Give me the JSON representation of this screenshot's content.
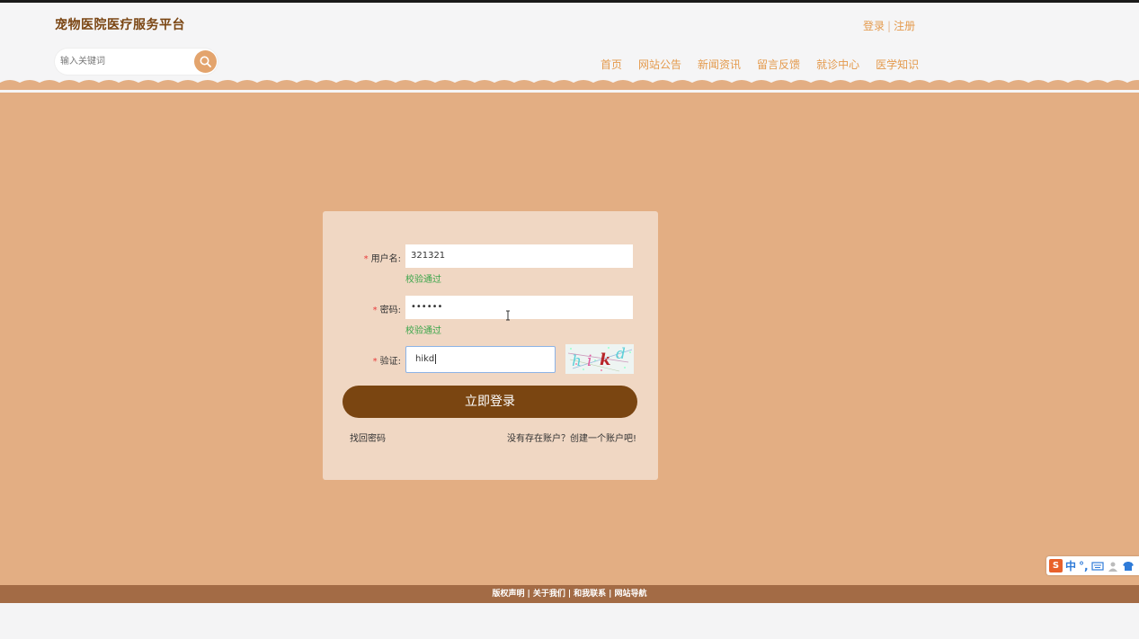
{
  "header": {
    "site_title": "宠物医院医疗服务平台",
    "login_label": "登录",
    "auth_separator": "|",
    "register_label": "注册"
  },
  "search": {
    "placeholder": "输入关键词",
    "icon": "search-icon"
  },
  "nav": {
    "items": [
      {
        "label": "首页"
      },
      {
        "label": "网站公告"
      },
      {
        "label": "新闻资讯"
      },
      {
        "label": "留言反馈"
      },
      {
        "label": "就诊中心"
      },
      {
        "label": "医学知识"
      }
    ]
  },
  "login_form": {
    "username": {
      "label": "用户名:",
      "value": "321321",
      "status": "校验通过"
    },
    "password": {
      "label": "密码:",
      "value": "••••••",
      "status": "校验通过"
    },
    "captcha": {
      "label": "验证:",
      "value": "hikd",
      "image_text": "hikd"
    },
    "required_mark": "*",
    "submit_label": "立即登录",
    "forgot_link": "找回密码",
    "register_link": "没有存在账户？创建一个账户吧!"
  },
  "footer": {
    "links": [
      "版权声明",
      "关于我们",
      "和我联系",
      "网站导航"
    ],
    "separator": "|"
  },
  "ime_toolbar": {
    "logo": "S",
    "mode": "中",
    "punct": "°,",
    "icons": [
      "keyboard-icon",
      "user-icon",
      "shirt-icon"
    ]
  },
  "colors": {
    "accent": "#e49a4d",
    "brand_dark": "#7a4511",
    "background": "#e3ae83",
    "card": "#f0d7c3",
    "success": "#3aa54a",
    "footer": "#a36b45"
  }
}
